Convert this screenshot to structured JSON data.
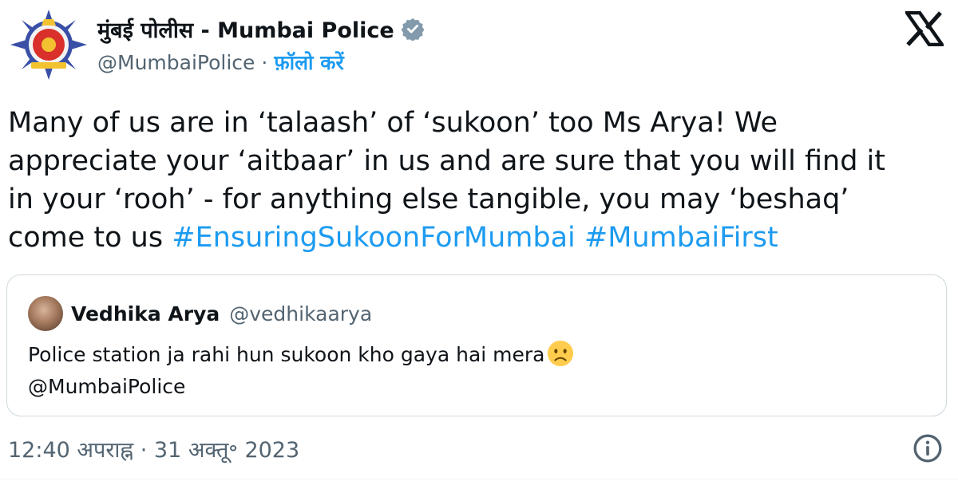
{
  "author": {
    "display_name": "मुंबई पोलीस - Mumbai Police",
    "handle": "@MumbaiPolice",
    "separator": "·",
    "follow_label": "फ़ॉलो करें",
    "verified": true,
    "avatar_icon": "mumbai-police-emblem"
  },
  "tweet": {
    "text_line1": "Many of us are in ‘talaash’ of ‘sukoon’ too Ms Arya! We",
    "text_line2": "appreciate your ‘aitbaar’ in us and are sure that you will find it",
    "text_line3": "in your ‘rooh’ - for anything else tangible, you may ‘beshaq’",
    "text_line4_prefix": "come to us",
    "hashtags": [
      "#EnsuringSukoonForMumbai",
      "#MumbaiFirst"
    ]
  },
  "quoted_tweet": {
    "display_name": "Vedhika Arya",
    "handle": "@vedhikaarya",
    "text_line1": "Police station ja rahi hun sukoon kho gaya hai mera",
    "emoji": "frowning-face-emoji",
    "text_line2": "@MumbaiPolice"
  },
  "meta": {
    "timestamp": "12:40 अपराह्न · 31 अक्तू॰ 2023"
  },
  "colors": {
    "link": "#1d9bf0",
    "secondary_text": "#536471",
    "border": "#cfd9de"
  }
}
